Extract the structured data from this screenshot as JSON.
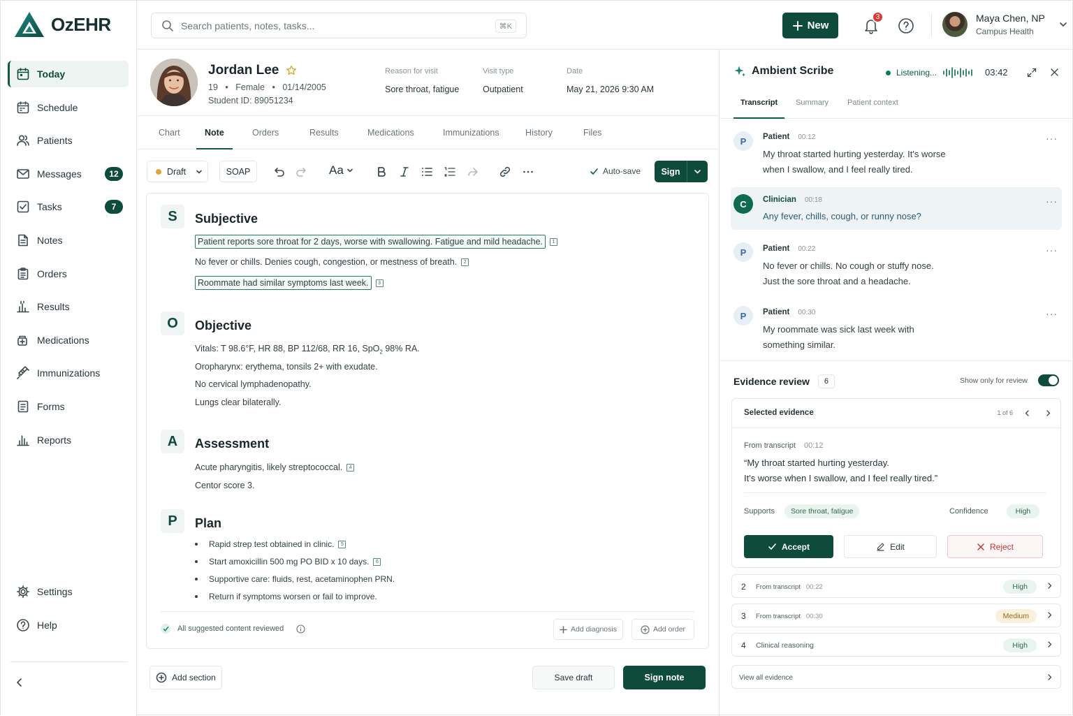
{
  "app": {
    "name": "OzEHR"
  },
  "sidebar": {
    "items": [
      {
        "label": "Today",
        "icon": "calendar-today-icon"
      },
      {
        "label": "Schedule",
        "icon": "calendar-icon"
      },
      {
        "label": "Patients",
        "icon": "users-icon"
      },
      {
        "label": "Messages",
        "icon": "mail-icon",
        "badge": "12"
      },
      {
        "label": "Tasks",
        "icon": "checkbox-icon",
        "badge": "7"
      },
      {
        "label": "Notes",
        "icon": "document-icon"
      },
      {
        "label": "Orders",
        "icon": "clipboard-icon"
      },
      {
        "label": "Results",
        "icon": "flask-chart-icon"
      },
      {
        "label": "Medications",
        "icon": "pill-icon"
      },
      {
        "label": "Immunizations",
        "icon": "syringe-icon"
      },
      {
        "label": "Forms",
        "icon": "form-icon"
      },
      {
        "label": "Reports",
        "icon": "bar-chart-icon"
      }
    ],
    "bottom": [
      {
        "label": "Settings",
        "icon": "gear-icon"
      },
      {
        "label": "Help",
        "icon": "help-circle-icon"
      }
    ]
  },
  "topbar": {
    "search_placeholder": "Search patients, notes, tasks...",
    "shortcut": "⌘K",
    "new_label": "New",
    "notifications_count": "3",
    "user": {
      "name": "Maya Chen, NP",
      "org": "Campus Health"
    }
  },
  "patient": {
    "name": "Jordan Lee",
    "age": "19",
    "sex": "Female",
    "dob": "01/14/2005",
    "student_id": "Student ID: 89051234",
    "reason_label": "Reason for visit",
    "reason": "Sore throat, fatigue",
    "visit_type_label": "Visit type",
    "visit_type": "Outpatient",
    "date_label": "Date",
    "date": "May 21, 2026 9:30 AM"
  },
  "tabs": [
    "Chart",
    "Note",
    "Orders",
    "Results",
    "Medications",
    "Immunizations",
    "History",
    "Files"
  ],
  "active_tab": "Note",
  "toolbar": {
    "status": "Draft",
    "template": "SOAP",
    "font_label": "Aa",
    "autosave": "Auto-save",
    "sign": "Sign"
  },
  "note": {
    "subjective": {
      "letter": "S",
      "title": "Subjective",
      "lines": [
        {
          "text": "Patient reports sore throat for 2 days, worse with swallowing. Fatigue and mild headache.",
          "cite": "1"
        },
        {
          "text": "No fever or chills. Denies cough, congestion, or mestness of breath.",
          "cite": "2"
        },
        {
          "text": "Roommate had similar symptoms last week.",
          "cite": "3"
        }
      ]
    },
    "objective": {
      "letter": "O",
      "title": "Objective",
      "vitals_prefix": "Vitals: T 98.6°F, HR 88, BP 112/68, RR 16, SpO",
      "vitals_sub": "2",
      "vitals_suffix": " 98% RA.",
      "lines": [
        "Oropharynx: erythema, tonsils 2+ with exudate.",
        "No cervical lymphadenopathy.",
        "Lungs clear bilaterally."
      ]
    },
    "assessment": {
      "letter": "A",
      "title": "Assessment",
      "lines": [
        {
          "text": "Acute pharyngitis, likely streptococcal.",
          "cite": "4"
        },
        {
          "text": "Centor score 3."
        }
      ]
    },
    "plan": {
      "letter": "P",
      "title": "Plan",
      "bullets": [
        {
          "text": "Rapid strep test obtained in clinic.",
          "cite": "5"
        },
        {
          "text": "Start amoxicillin 500 mg PO BID x 10 days.",
          "cite": "6"
        },
        {
          "text": "Supportive care: fluids, rest, acetaminophen PRN."
        },
        {
          "text": "Return if symptoms worsen or fail to improve."
        }
      ]
    },
    "footer": {
      "reviewed": "All suggested content reviewed",
      "add_diagnosis": "Add diagnosis",
      "add_order": "Add order"
    }
  },
  "actions": {
    "add_section": "Add section",
    "save_draft": "Save draft",
    "sign_note": "Sign note"
  },
  "scribe": {
    "title": "Ambient Scribe",
    "status": "Listening...",
    "timer": "03:42",
    "tabs": [
      "Transcript",
      "Summary",
      "Patient context"
    ],
    "transcript": [
      {
        "initial": "P",
        "speaker": "Patient",
        "time": "00:12",
        "lines": [
          "My throat started hurting yesterday. It's worse",
          "when I swallow, and I feel really tired."
        ]
      },
      {
        "initial": "C",
        "speaker": "Clinician",
        "time": "00:18",
        "lines": [
          "Any fever, chills, cough, or runny nose?"
        ]
      },
      {
        "initial": "P",
        "speaker": "Patient",
        "time": "00:22",
        "lines": [
          "No fever or chills. No cough or stuffy nose.",
          "Just the sore throat and a headache."
        ]
      },
      {
        "initial": "P",
        "speaker": "Patient",
        "time": "00:30",
        "lines": [
          "My roommate was sick last week with",
          "something similar."
        ]
      }
    ]
  },
  "evidence": {
    "title": "Evidence review",
    "count": "6",
    "toggle_label": "Show only for review",
    "selected": {
      "title": "Selected evidence",
      "page": "1 of 6",
      "source": "From transcript",
      "time": "00:12",
      "quote_1": "“My throat started hurting yesterday.",
      "quote_2": "It's worse when I swallow, and I feel really tired.”",
      "supports_label": "Supports",
      "supports": "Sore throat, fatigue",
      "confidence_label": "Confidence",
      "confidence": "High",
      "accept": "Accept",
      "edit": "Edit",
      "reject": "Reject"
    },
    "rows": [
      {
        "n": "2",
        "source": "From transcript",
        "time": "00:22",
        "confidence": "High"
      },
      {
        "n": "3",
        "source": "From transcript",
        "time": "00:30",
        "confidence": "Medium"
      },
      {
        "n": "4",
        "source": "Clinical reasoning",
        "time": "",
        "confidence": "High"
      }
    ],
    "view_all": "View all evidence"
  },
  "colors": {
    "brand": "#0f4b3a",
    "accent_teal": "#1d7f79",
    "danger": "#c43636",
    "warning": "#e2a53a"
  }
}
